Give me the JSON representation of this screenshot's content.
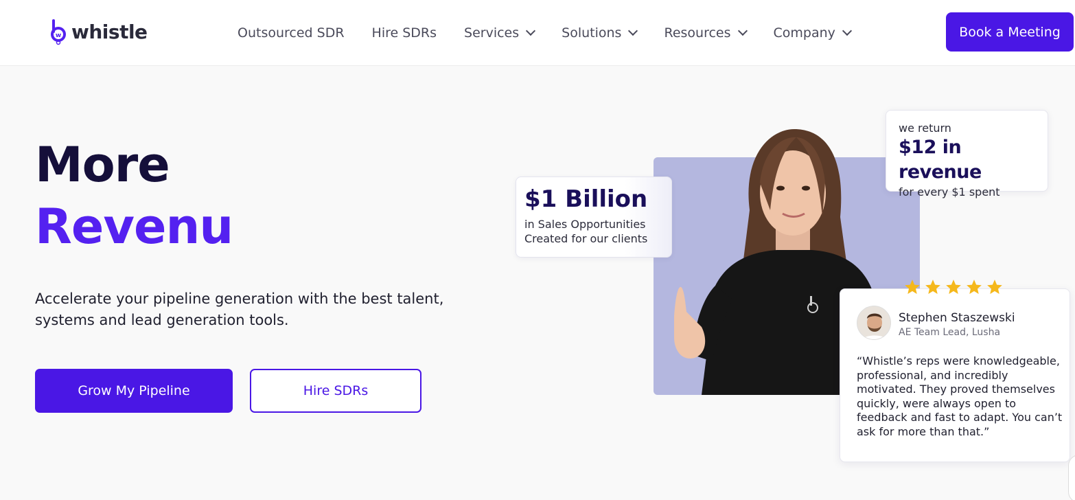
{
  "header": {
    "logo_text": "whistle",
    "nav": [
      {
        "label": "Outsourced SDR",
        "has_dropdown": false
      },
      {
        "label": "Hire SDRs",
        "has_dropdown": false
      },
      {
        "label": "Services",
        "has_dropdown": true
      },
      {
        "label": "Solutions",
        "has_dropdown": true
      },
      {
        "label": "Resources",
        "has_dropdown": true
      },
      {
        "label": "Company",
        "has_dropdown": true
      }
    ],
    "cta_label": "Book a Meeting"
  },
  "hero": {
    "title_line1": "More",
    "title_line2": "Revenu",
    "subtitle": "Accelerate your pipeline generation with the best talent, systems and lead generation tools.",
    "primary_cta": "Grow My Pipeline",
    "secondary_cta": "Hire SDRs"
  },
  "stats": {
    "billion": {
      "value": "$1 Billion",
      "line1": "in Sales Opportunities",
      "line2": "Created for our clients"
    },
    "revenue": {
      "pre": "we return",
      "value": "$12 in revenue",
      "post": "for every $1 spent"
    }
  },
  "testimonial": {
    "rating": 5,
    "name": "Stephen Staszewski",
    "role": "AE Team Lead, Lusha",
    "quote": "“Whistle’s reps were knowledgeable, professional, and incredibly motivated. They proved themselves quickly, were always open to feedback and fast to adapt. You can’t ask for more than that.”"
  },
  "colors": {
    "brand": "#4a17e5",
    "title_dark": "#150f3a",
    "title_accent": "#5421f0",
    "photo_bg": "#b4b7df",
    "star": "#f5b81c"
  }
}
